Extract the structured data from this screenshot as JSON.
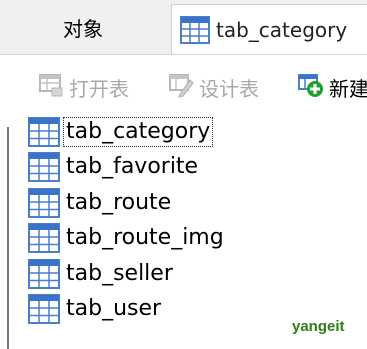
{
  "tabs": {
    "objects_label": "对象",
    "doc_tab_label": "tab_category"
  },
  "toolbar": {
    "open_label": "打开表",
    "design_label": "设计表",
    "new_label": "新建"
  },
  "tables": [
    {
      "name": "tab_category",
      "icon": "table-icon",
      "selected": true
    },
    {
      "name": "tab_favorite",
      "icon": "table-icon",
      "selected": false
    },
    {
      "name": "tab_route",
      "icon": "table-icon",
      "selected": false
    },
    {
      "name": "tab_route_img",
      "icon": "table-icon",
      "selected": false
    },
    {
      "name": "tab_seller",
      "icon": "table-icon",
      "selected": false
    },
    {
      "name": "tab_user",
      "icon": "table-icon",
      "selected": false
    }
  ],
  "watermark": "yangeit",
  "colors": {
    "table_icon_header": "#3a73c7",
    "table_icon_grid": "#4a7fca",
    "add_icon_green": "#1fa131",
    "disabled_text": "#a9a9a9",
    "watermark": "#2e7d16"
  }
}
